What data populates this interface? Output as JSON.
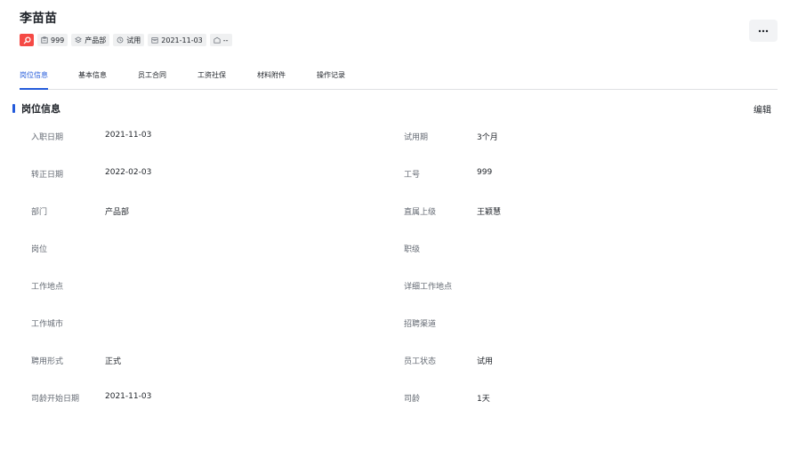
{
  "employee": {
    "name": "李苗苗",
    "tags": {
      "search_icon": "search-icon",
      "id": "999",
      "department": "产品部",
      "status": "试用",
      "hire_date": "2021-11-03",
      "other": "--"
    }
  },
  "more_button_label": "···",
  "tabs": [
    {
      "label": "岗位信息",
      "active": true
    },
    {
      "label": "基本信息",
      "active": false
    },
    {
      "label": "员工合同",
      "active": false
    },
    {
      "label": "工资社保",
      "active": false
    },
    {
      "label": "材料附件",
      "active": false
    },
    {
      "label": "操作记录",
      "active": false
    }
  ],
  "section": {
    "title": "岗位信息",
    "edit_label": "编辑"
  },
  "fields": {
    "left": [
      {
        "label": "入职日期",
        "value": "2021-11-03"
      },
      {
        "label": "转正日期",
        "value": "2022-02-03"
      },
      {
        "label": "部门",
        "value": "产品部"
      },
      {
        "label": "岗位",
        "value": ""
      },
      {
        "label": "工作地点",
        "value": ""
      },
      {
        "label": "工作城市",
        "value": ""
      },
      {
        "label": "聘用形式",
        "value": "正式"
      },
      {
        "label": "司龄开始日期",
        "value": "2021-11-03"
      }
    ],
    "right": [
      {
        "label": "试用期",
        "value": "3个月"
      },
      {
        "label": "工号",
        "value": "999"
      },
      {
        "label": "直属上级",
        "value": "王颖慧"
      },
      {
        "label": "职级",
        "value": ""
      },
      {
        "label": "详细工作地点",
        "value": ""
      },
      {
        "label": "招聘渠道",
        "value": ""
      },
      {
        "label": "员工状态",
        "value": "试用"
      },
      {
        "label": "司龄",
        "value": "1天"
      }
    ]
  },
  "colors": {
    "accent": "#245bdb",
    "danger": "#f54a45",
    "label": "#646a73",
    "text": "#1f2329"
  }
}
